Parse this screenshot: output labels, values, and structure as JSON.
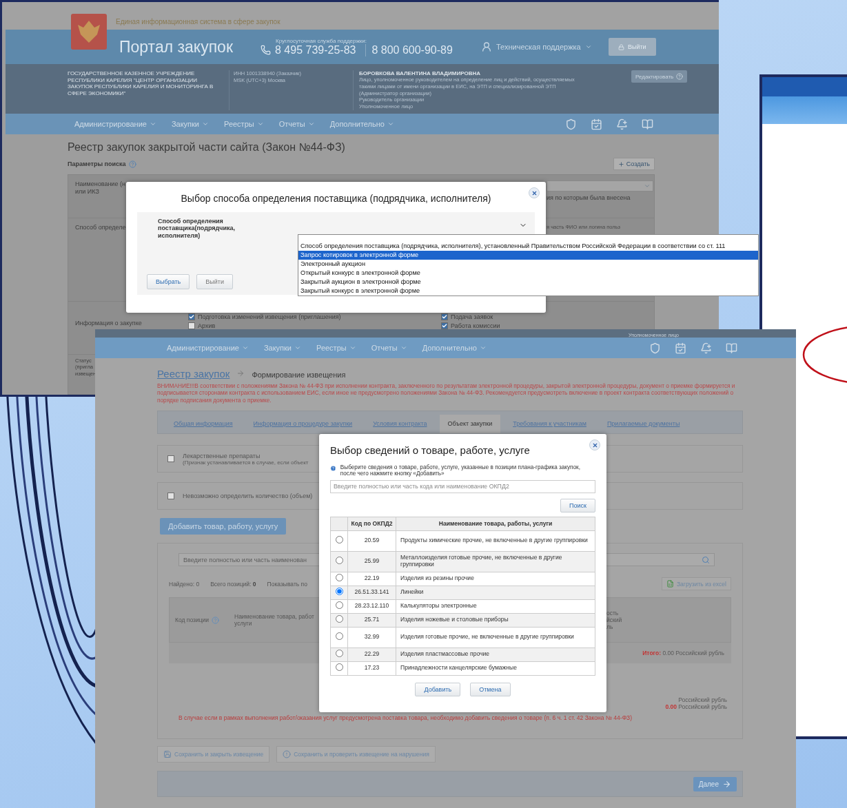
{
  "screen_1": {
    "header": {
      "subtitle": "Единая информационная система в сфере закупок",
      "title": "Портал закупок",
      "support_label": "Круглосуточная служба поддержки:",
      "phones": [
        "8 495 739-25-83",
        "8 800 600-90-89"
      ],
      "tech_support": "Техническая поддержка",
      "logout": "Выйти"
    },
    "org": {
      "name": "ГОСУДАРСТВЕННОЕ КАЗЕННОЕ УЧРЕЖДЕНИЕ РЕСПУБЛИКИ КАРЕЛИЯ \"ЦЕНТР ОРГАНИЗАЦИИ ЗАКУПОК РЕСПУБЛИКИ КАРЕЛИЯ И МОНИТОРИНГА В СФЕРЕ ЭКОНОМИКИ\"",
      "inn": "ИНН 1001338940 (Заказчик)",
      "timezone": "MSK (UTC+3) Москва",
      "user": "БОРОВКОВА ВАЛЕНТИНА ВЛАДИМИРОВНА",
      "roles": [
        "Лицо, уполномоченное руководителем на определение лиц и действий, осуществляемых такими лицами от имени организации в ЕИС, на ЭТП и специализированной ЭТП (Администратор организации)",
        "Руководитель организации",
        "Уполномоченное лицо"
      ],
      "edit": "Редактировать"
    },
    "nav": [
      "Администрирование",
      "Закупки",
      "Реестры",
      "Отчеты",
      "Дополнительно"
    ],
    "page_title": "Реестр закупок закрытой части сайта (Закон №44-ФЗ)",
    "search_params": "Параметры поиска",
    "create": "Создать",
    "form": {
      "name_label": [
        "Наименование (н",
        "или ИКЗ"
      ],
      "name_hint": "ия по которым была внесена",
      "method_label": "Способ определе",
      "method_hint": "я часть ФИО или логина польз",
      "info_label": "Информация о закупке",
      "status_label": [
        "Статус",
        "(пригла",
        "извещен"
      ],
      "checkboxes": [
        {
          "label": "Подготовка изменений извещения (приглашения)",
          "checked": true
        },
        {
          "label": "Подача заявок",
          "checked": true
        },
        {
          "label": "Архив",
          "checked": false
        },
        {
          "label": "Работа комиссии",
          "checked": true
        }
      ]
    },
    "dialog": {
      "title": "Выбор способа определения поставщика (подрядчика, исполнителя)",
      "field_label": "Способ определения поставщика(подрядчика, исполнителя)",
      "buttons": [
        "Выбрать",
        "Выйти"
      ],
      "options": [
        {
          "label": "Способ определения поставщика (подрядчика, исполнителя), установленный Правительством Российской Федерации в соответствии со ст. 111",
          "selected": false
        },
        {
          "label": "Запрос котировок в электронной форме",
          "selected": true
        },
        {
          "label": "Электронный аукцион",
          "selected": false
        },
        {
          "label": "Открытый конкурс в электронной форме",
          "selected": false
        },
        {
          "label": "Закрытый аукцион в электронной форме",
          "selected": false
        },
        {
          "label": "Закрытый конкурс в электронной форме",
          "selected": false
        }
      ]
    }
  },
  "screen_2": {
    "top_text": "Уполномоченное лицо",
    "nav": [
      "Администрирование",
      "Закупки",
      "Реестры",
      "Отчеты",
      "Дополнительно"
    ],
    "breadcrumb": {
      "link": "Реестр закупок",
      "current": "Формирование извещения"
    },
    "warning": "ВНИМАНИЕ!!!В соответствии с положениями Закона № 44-ФЗ при исполнении контракта, заключенного по результатам электронной процедуры, закрытой электронной процедуры, документ о приемке формируется и подписывается сторонами контракта с использованием ЕИС, если иное не предусмотрено положениями Закона № 44-ФЗ. Рекомендуется предусмотреть включение в проект контракта соответствующих положений о порядке подписания документа о приемке.",
    "tabs": [
      {
        "label": "Общая информация",
        "selected": false
      },
      {
        "label": "Информация о процедуре закупки",
        "selected": false
      },
      {
        "label": "Условия контракта",
        "selected": false
      },
      {
        "label": "Объект закупки",
        "selected": true
      },
      {
        "label": "Требования к участникам",
        "selected": false
      },
      {
        "label": "Прилагаемые документы",
        "selected": false
      }
    ],
    "options": [
      {
        "label": "Лекарственные препараты",
        "note": "(Признак устанавливается в случае, если объект",
        "checked": false
      },
      {
        "label": "Невозможно определить количество (объем)",
        "checked": false
      }
    ],
    "add_button": "Добавить товар, работу, услугу",
    "search_placeholder": "Введите полностью или часть наименован",
    "found": "Найдено: 0",
    "total": "Всего позиций: **0**",
    "per_page": "Показывать по",
    "excel": "Загрузить из excel",
    "columns": [
      [
        "Код позиции"
      ],
      [
        "Наименование товара, работ",
        "услуги"
      ],
      [
        "ость",
        "йский",
        "ль"
      ]
    ],
    "summary": "**Итого:** 0.00 Российский рубль",
    "currency_lines": [
      "Российский рубль",
      "**0.00** Российский рубль"
    ],
    "note": "В случае если в рамках выполнения работ/оказания услуг предусмотрена поставка товара, необходимо добавить сведения о товаре (п. 6 ч. 1 ст. 42 Закона № 44-ФЗ)",
    "save_close": "Сохранить и закрыть извещение",
    "save_check": "Сохранить и проверить извещение на нарушения",
    "next": "Далее",
    "dialog": {
      "title": "Выбор сведений о товаре, работе, услуге",
      "hint": "Выберите сведения о товаре, работе, услуге, указанные в позиции плана-графика закупок, после чего нажмите кнопку «Добавить»",
      "placeholder": "Введите полностью или часть кода или наименование ОКПД2",
      "search": "Поиск",
      "columns": [
        "Код по ОКПД2",
        "Наименование товара, работы, услуги"
      ],
      "rows": [
        {
          "code": "20.59",
          "name": "Продукты химические прочие, не включенные в другие группировки",
          "selected": false
        },
        {
          "code": "25.99",
          "name": "Металлоизделия готовые прочие, не включенные в другие группировки",
          "selected": false
        },
        {
          "code": "22.19",
          "name": "Изделия из резины прочие",
          "selected": false
        },
        {
          "code": "26.51.33.141",
          "name": "Линейки",
          "selected": true
        },
        {
          "code": "28.23.12.110",
          "name": "Калькуляторы электронные",
          "selected": false
        },
        {
          "code": "25.71",
          "name": "Изделия ножевые и столовые приборы",
          "selected": false
        },
        {
          "code": "32.99",
          "name": "Изделия готовые прочие, не включенные в другие группировки",
          "selected": false
        },
        {
          "code": "22.29",
          "name": "Изделия пластмассовые прочие",
          "selected": false
        },
        {
          "code": "17.23",
          "name": "Принадлежности канцелярские бумажные",
          "selected": false
        }
      ],
      "buttons": [
        "Добавить",
        "Отмена"
      ]
    }
  }
}
